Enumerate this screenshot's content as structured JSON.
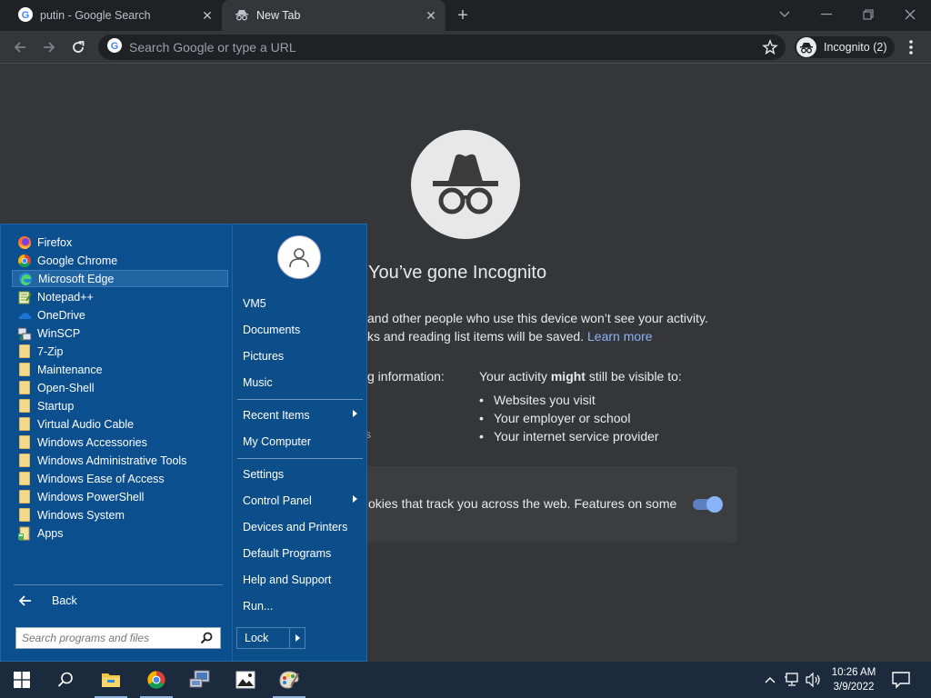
{
  "browser": {
    "tabs": [
      {
        "title": "putin - Google Search",
        "icon": "google-g-icon"
      },
      {
        "title": "New Tab",
        "icon": "incognito-icon"
      }
    ],
    "omnibox": {
      "placeholder": "Search Google or type a URL"
    },
    "profile_chip": "Incognito (2)"
  },
  "incognito_page": {
    "heading": "You’ve gone Incognito",
    "line1": "and other people who use this device won’t see your activity.",
    "line2": "ks and reading list items will be saved.",
    "learn_more": "Learn more",
    "left_col_heading": "g information:",
    "left_col_fragment": "s",
    "right_col_heading_pre": "Your activity ",
    "right_col_heading_bold": "might",
    "right_col_heading_post": " still be visible to:",
    "visible_to": [
      "Websites you visit",
      "Your employer or school",
      "Your internet service provider"
    ],
    "cookie_text": "okies that track you across the web. Features on some",
    "cookie_toggle_on": true
  },
  "start_menu": {
    "programs": [
      {
        "label": "Firefox",
        "icon": "firefox-icon"
      },
      {
        "label": "Google Chrome",
        "icon": "chrome-icon"
      },
      {
        "label": "Microsoft Edge",
        "icon": "edge-icon"
      },
      {
        "label": "Notepad++",
        "icon": "notepadpp-icon"
      },
      {
        "label": "OneDrive",
        "icon": "onedrive-icon"
      },
      {
        "label": "WinSCP",
        "icon": "winscp-icon"
      },
      {
        "label": "7-Zip",
        "icon": "folder-icon"
      },
      {
        "label": "Maintenance",
        "icon": "folder-icon"
      },
      {
        "label": "Open-Shell",
        "icon": "folder-icon"
      },
      {
        "label": "Startup",
        "icon": "folder-icon"
      },
      {
        "label": "Virtual Audio Cable",
        "icon": "folder-icon"
      },
      {
        "label": "Windows Accessories",
        "icon": "folder-icon"
      },
      {
        "label": "Windows Administrative Tools",
        "icon": "folder-icon"
      },
      {
        "label": "Windows Ease of Access",
        "icon": "folder-icon"
      },
      {
        "label": "Windows PowerShell",
        "icon": "folder-icon"
      },
      {
        "label": "Windows System",
        "icon": "folder-icon"
      },
      {
        "label": "Apps",
        "icon": "apps-icon"
      }
    ],
    "back_label": "Back",
    "search_placeholder": "Search programs and files",
    "places": {
      "user": "VM5",
      "documents": "Documents",
      "pictures": "Pictures",
      "music": "Music",
      "recent_items": "Recent Items",
      "my_computer": "My Computer",
      "settings": "Settings",
      "control_panel": "Control Panel",
      "devices_printers": "Devices and Printers",
      "default_programs": "Default Programs",
      "help_support": "Help and Support",
      "run": "Run..."
    },
    "lock_label": "Lock"
  },
  "taskbar": {
    "pinned": [
      "start-icon",
      "search-icon",
      "file-explorer-icon",
      "chrome-icon",
      "network-app-icon",
      "photos-icon",
      "paint-icon"
    ],
    "clock_time": "10:26 AM",
    "clock_date": "3/9/2022"
  },
  "colors": {
    "browser_bg": "#35363a",
    "tabstrip_bg": "#202124",
    "start_menu_bg": "#0b4f8f",
    "taskbar_bg": "#1b2a3c",
    "link": "#8ab4f8"
  }
}
